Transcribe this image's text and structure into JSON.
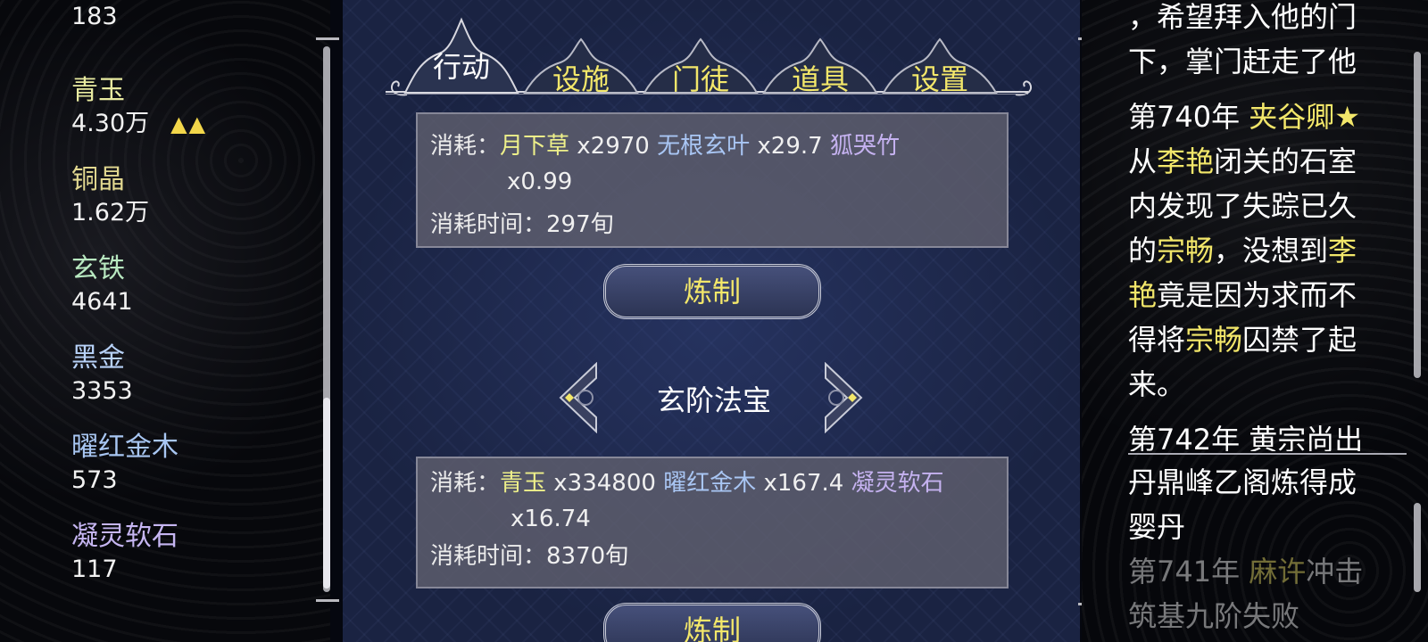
{
  "resources": [
    {
      "name": "",
      "value": "183",
      "color": "#ffffff"
    },
    {
      "name": "青玉",
      "value": "4.30万",
      "trend": "▲▲",
      "color": "#e8eaa0"
    },
    {
      "name": "铜晶",
      "value": "1.62万",
      "color": "#e2d890"
    },
    {
      "name": "玄铁",
      "value": "4641",
      "color": "#b8e8c0"
    },
    {
      "name": "黑金",
      "value": "3353",
      "color": "#b8d2f8"
    },
    {
      "name": "曜红金木",
      "value": "573",
      "color": "#a8c6f2"
    },
    {
      "name": "凝灵软石",
      "value": "117",
      "color": "#c6b6f2"
    }
  ],
  "tabs": [
    {
      "label": "行动",
      "active": true
    },
    {
      "label": "设施"
    },
    {
      "label": "门徒"
    },
    {
      "label": "道具"
    },
    {
      "label": "设置"
    }
  ],
  "recipes": [
    {
      "cost_label": "消耗：",
      "items": [
        {
          "name": "月下草",
          "qty": "x2970",
          "color": "#eef08a"
        },
        {
          "name": "无根玄叶",
          "qty": "x29.7",
          "color": "#a9c6f4"
        },
        {
          "name": "狐哭竹",
          "qty": "x0.99",
          "color": "#c5b2f0"
        }
      ],
      "time_label": "消耗时间：",
      "time": "297旬",
      "button": "炼制"
    },
    {
      "cost_label": "消耗：",
      "items": [
        {
          "name": "青玉",
          "qty": "x334800",
          "color": "#eef08a"
        },
        {
          "name": "曜红金木",
          "qty": "x167.4",
          "color": "#a9c6f4"
        },
        {
          "name": "凝灵软石",
          "qty": "x16.74",
          "color": "#c5b2f0"
        }
      ],
      "time_label": "消耗时间：",
      "time": "8370旬",
      "button": "炼制"
    }
  ],
  "category": {
    "label": "玄阶法宝"
  },
  "log": {
    "line1": "，希望拜入他的门",
    "line2": "下，掌门赶走了他",
    "entry1": {
      "year": "第740年",
      "p1": "夹谷卿★",
      "p2": "从",
      "p3": "李艳",
      "p4": "闭关的石室",
      "p5": "内发现了失踪已久",
      "p6": "的",
      "p7": "宗畅",
      "p8": "，没想到",
      "p9": "李",
      "p10": "艳",
      "p11": "竟是因为求而不",
      "p12": "得将",
      "p13": "宗畅",
      "p14": "囚禁了起",
      "p15": "来。"
    },
    "cut_line": "第742年 黄宗尚出",
    "entry2_l1": "丹鼎峰乙阁炼得成",
    "entry2_l2": "婴丹",
    "entry3": {
      "year": "第741年",
      "name": "麻许",
      "rest": "冲击",
      "l2": "筑基九阶失败"
    }
  }
}
